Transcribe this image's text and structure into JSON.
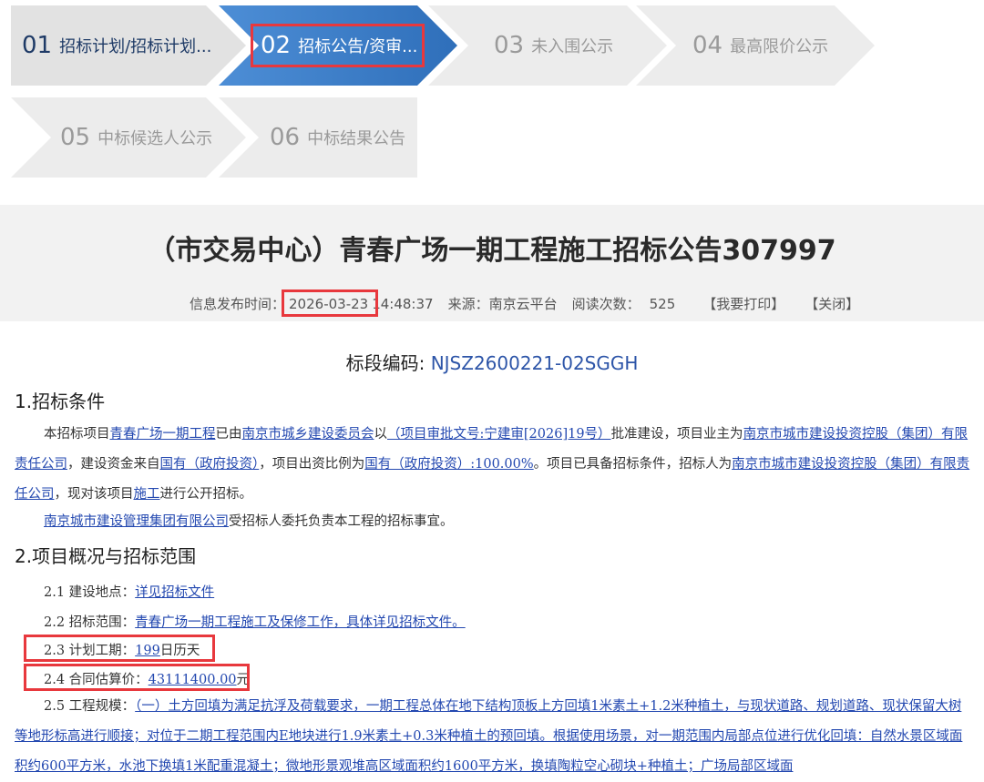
{
  "steps": [
    {
      "num": "01",
      "label": "招标计划/招标计划...",
      "state": "done"
    },
    {
      "num": "02",
      "label": "招标公告/资审...",
      "state": "active"
    },
    {
      "num": "03",
      "label": "未入围公示",
      "state": "todo"
    },
    {
      "num": "04",
      "label": "最高限价公示",
      "state": "todo"
    },
    {
      "num": "05",
      "label": "中标候选人公示",
      "state": "todo"
    },
    {
      "num": "06",
      "label": "中标结果公告",
      "state": "todo"
    }
  ],
  "title": "（市交易中心）青春广场一期工程施工招标公告307997",
  "meta": {
    "publish_label": "信息发布时间：",
    "publish_date": "2026-03-23",
    "publish_time": "14:48:37",
    "source_label": "来源：",
    "source": "南京云平台",
    "views_label": "阅读次数：",
    "views": "525",
    "print": "【我要打印】",
    "close": "【关闭】"
  },
  "bidcode": {
    "label": "标段编码: ",
    "value": "NJSZ2600221-02SGGH"
  },
  "section1": {
    "heading": "1.招标条件",
    "p1": {
      "t1": "本招标项目",
      "l1": "青春广场一期工程",
      "t2": "已由",
      "l2": "南京市城乡建设委员会",
      "t3": "以",
      "l3": "（项目审批文号:宁建审[2026]19号）",
      "t4": "批准建设，项目业主为",
      "l4": "南京市城市建设投资控股（集团）有限责任公司",
      "t5": "，建设资金来自",
      "l5": "国有（政府投资）",
      "t6": "，项目出资比例为",
      "l6": "国有（政府投资）:100.00%",
      "t7": "。项目已具备招标条件，招标人为",
      "l7": "南京市城市建设投资控股（集团）有限责任公司",
      "t8": "，现对该项目",
      "l8": "施工",
      "t9": "进行公开招标。"
    },
    "p2": {
      "l1": "南京城市建设管理集团有限公司",
      "t1": "受招标人委托负责本工程的招标事宜。"
    }
  },
  "section2": {
    "heading": "2.项目概况与招标范围",
    "items": [
      {
        "label": "2.1 建设地点：",
        "value": "详见招标文件",
        "suffix": ""
      },
      {
        "label": "2.2 招标范围：",
        "value": "青春广场一期工程施工及保修工作，具体详见招标文件。",
        "suffix": ""
      },
      {
        "label": "2.3 计划工期：",
        "value": "199",
        "suffix": "日历天"
      },
      {
        "label": "2.4 合同估算价：",
        "value": "43111400.00",
        "suffix": "元"
      }
    ],
    "item5_label": "2.5 工程规模：",
    "item5_text": "（一）土方回填为满足抗浮及荷载要求，一期工程总体在地下结构顶板上方回填1米素土+1.2米种植土，与现状道路、规划道路、现状保留大树等地形标高进行顺接；对位于二期工程范围内E地块进行1.9米素土+0.3米种植土的预回填。根据使用场景，对一期范围内局部点位进行优化回填：自然水景区域面积约600平方米，水池下换填1米配重混凝土；微地形景观堆高区域面积约1600平方米，换填陶粒空心砌块+种植土；广场局部区域面"
  },
  "colors": {
    "accent": "#2f6fba",
    "link": "#2348b0",
    "highlight": "#e8383d"
  }
}
